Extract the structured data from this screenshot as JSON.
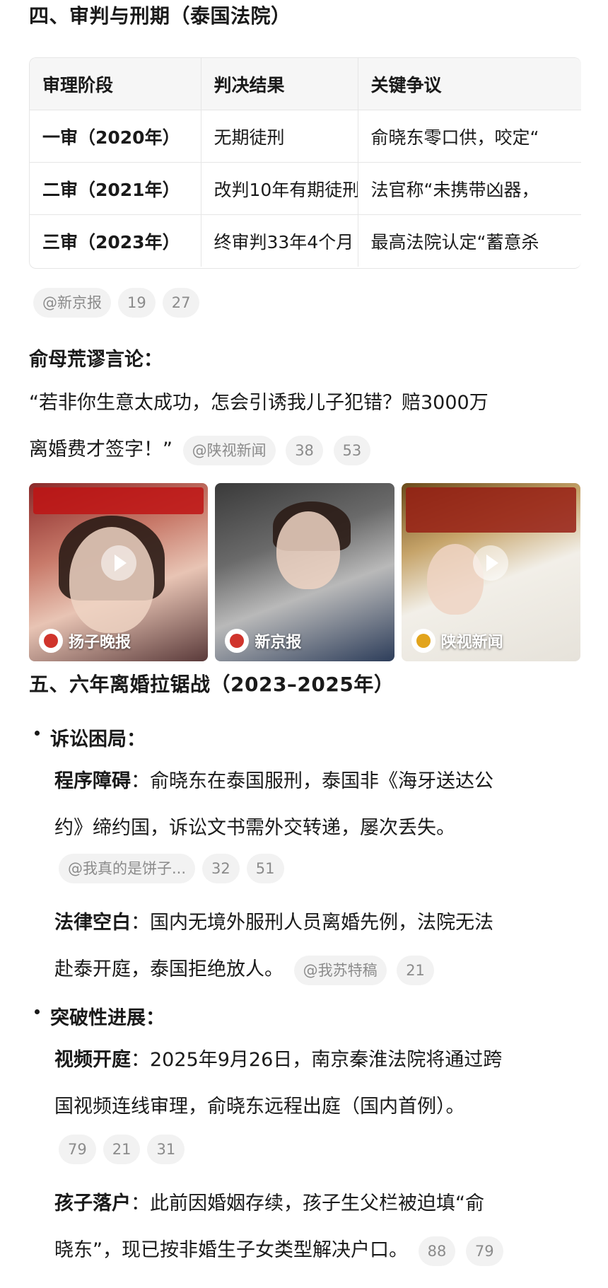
{
  "section4": {
    "title": "四、审判与刑期（泰国法院）",
    "table": {
      "headers": [
        "审理阶段",
        "判决结果",
        "关键争议"
      ],
      "rows": [
        [
          "一审（2020年）",
          "无期徒刑",
          "俞晓东零口供，咬定“"
        ],
        [
          "二审（2021年）",
          "改判10年有期徒刑",
          "法官称“未携带凶器，"
        ],
        [
          "三审（2023年）",
          "终审判33年4个月",
          "最高法院认定“蓄意杀"
        ]
      ]
    },
    "table_chips": [
      "@新京报",
      "19",
      "27"
    ]
  },
  "mother_quote": {
    "heading": "俞母荒谬言论：",
    "line1": "“若非你生意太成功，怎会引诱我儿子犯错？赔3000万",
    "line2": "离婚费才签字！”",
    "chips": [
      "@陕视新闻",
      "38",
      "53"
    ]
  },
  "videos": [
    {
      "source": "扬子晚报",
      "icon": "play-icon"
    },
    {
      "source": "新京报",
      "icon": "play-icon"
    },
    {
      "source": "陕视新闻",
      "icon": "play-icon"
    }
  ],
  "section5": {
    "title": "五、六年离婚拉锯战（2023–2025年）",
    "bullet1": {
      "label": "诉讼困局：",
      "item1": {
        "term": "程序障碍",
        "sep": "：",
        "line1": "俞晓东在泰国服刑，泰国非《海牙送达公",
        "line2": "约》缔约国，诉讼文书需外交转递，屡次丢失。",
        "chips": [
          "@我真的是饼子...",
          "32",
          "51"
        ]
      },
      "item2": {
        "term": "法律空白",
        "sep": "：",
        "line1": "国内无境外服刑人员离婚先例，法院无法",
        "line2": "赴泰开庭，泰国拒绝放人。",
        "chips": [
          "@我苏特稿",
          "21"
        ]
      }
    },
    "bullet2": {
      "label": "突破性进展：",
      "item1": {
        "term": "视频开庭",
        "sep": "：",
        "line1": "2025年9月26日，南京秦淮法院将通过跨",
        "line2": "国视频连线审理，俞晓东远程出庭（国内首例）。",
        "chips": [
          "79",
          "21",
          "31"
        ]
      },
      "item2": {
        "term": "孩子落户",
        "sep": "：",
        "line1": "此前因婚姻存续，孩子生父栏被迫填“俞",
        "line2": "晓东”，现已按非婚生子女类型解决户口。",
        "chips": [
          "88",
          "79"
        ]
      }
    }
  }
}
